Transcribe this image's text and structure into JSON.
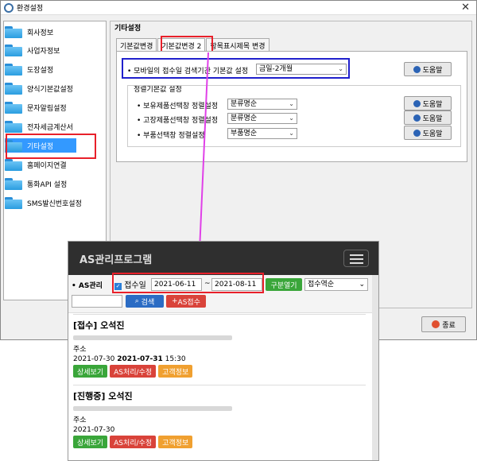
{
  "window": {
    "title": "환경설정",
    "close_glyph": "✕"
  },
  "sidebar": {
    "items": [
      {
        "label": "회사정보"
      },
      {
        "label": "사업자정보"
      },
      {
        "label": "도장설정"
      },
      {
        "label": "양식기본값설정"
      },
      {
        "label": "문자알림설정"
      },
      {
        "label": "전자세금계산서"
      },
      {
        "label": "기타설정"
      },
      {
        "label": "홈페이지연결"
      },
      {
        "label": "통화API 설정"
      },
      {
        "label": "SMS발신번호설정"
      }
    ],
    "selected": "기타설정"
  },
  "pane": {
    "title": "기타설정",
    "tabs": [
      "기본값변경",
      "기본값변경 2",
      "항목표시제목 변경"
    ],
    "active_tab": "기본값변경 2",
    "mobile_period_label": "• 모바일의 접수일 검색기간 기본값 설정",
    "mobile_period_value": "금일-2개월",
    "help_label": "도움말",
    "sort_group_label": "정렬기본값 설정",
    "sort_rows": [
      {
        "label": "• 보유제품선택창 정렬설정",
        "value": "분류명순"
      },
      {
        "label": "• 고장제품선택창 정렬설정",
        "value": "분류명순"
      },
      {
        "label": "• 부품선택창 정렬설정",
        "value": "부품명순"
      }
    ],
    "close_label": "종료"
  },
  "mobile": {
    "title": "AS관리프로그램",
    "section_label": "• AS관리",
    "date_checkbox_label": "접수일",
    "date_from": "2021-06-11",
    "date_sep": "~",
    "date_to": "2021-08-11",
    "toggle_btn": "구분열기",
    "sort_select": "접수역순",
    "search_btn": "검색",
    "add_btn": "AS접수",
    "cards": [
      {
        "title": "[접수] 오석진",
        "addr": "주소",
        "date_plain": "2021-07-30",
        "date_bold": "2021-07-31",
        "time": "15:30"
      },
      {
        "title": "[진행중] 오석진",
        "addr": "주소",
        "date_plain": "2021-07-30",
        "date_bold": "",
        "time": ""
      }
    ],
    "card_buttons": [
      "상세보기",
      "AS처리/수정",
      "고객정보"
    ]
  }
}
